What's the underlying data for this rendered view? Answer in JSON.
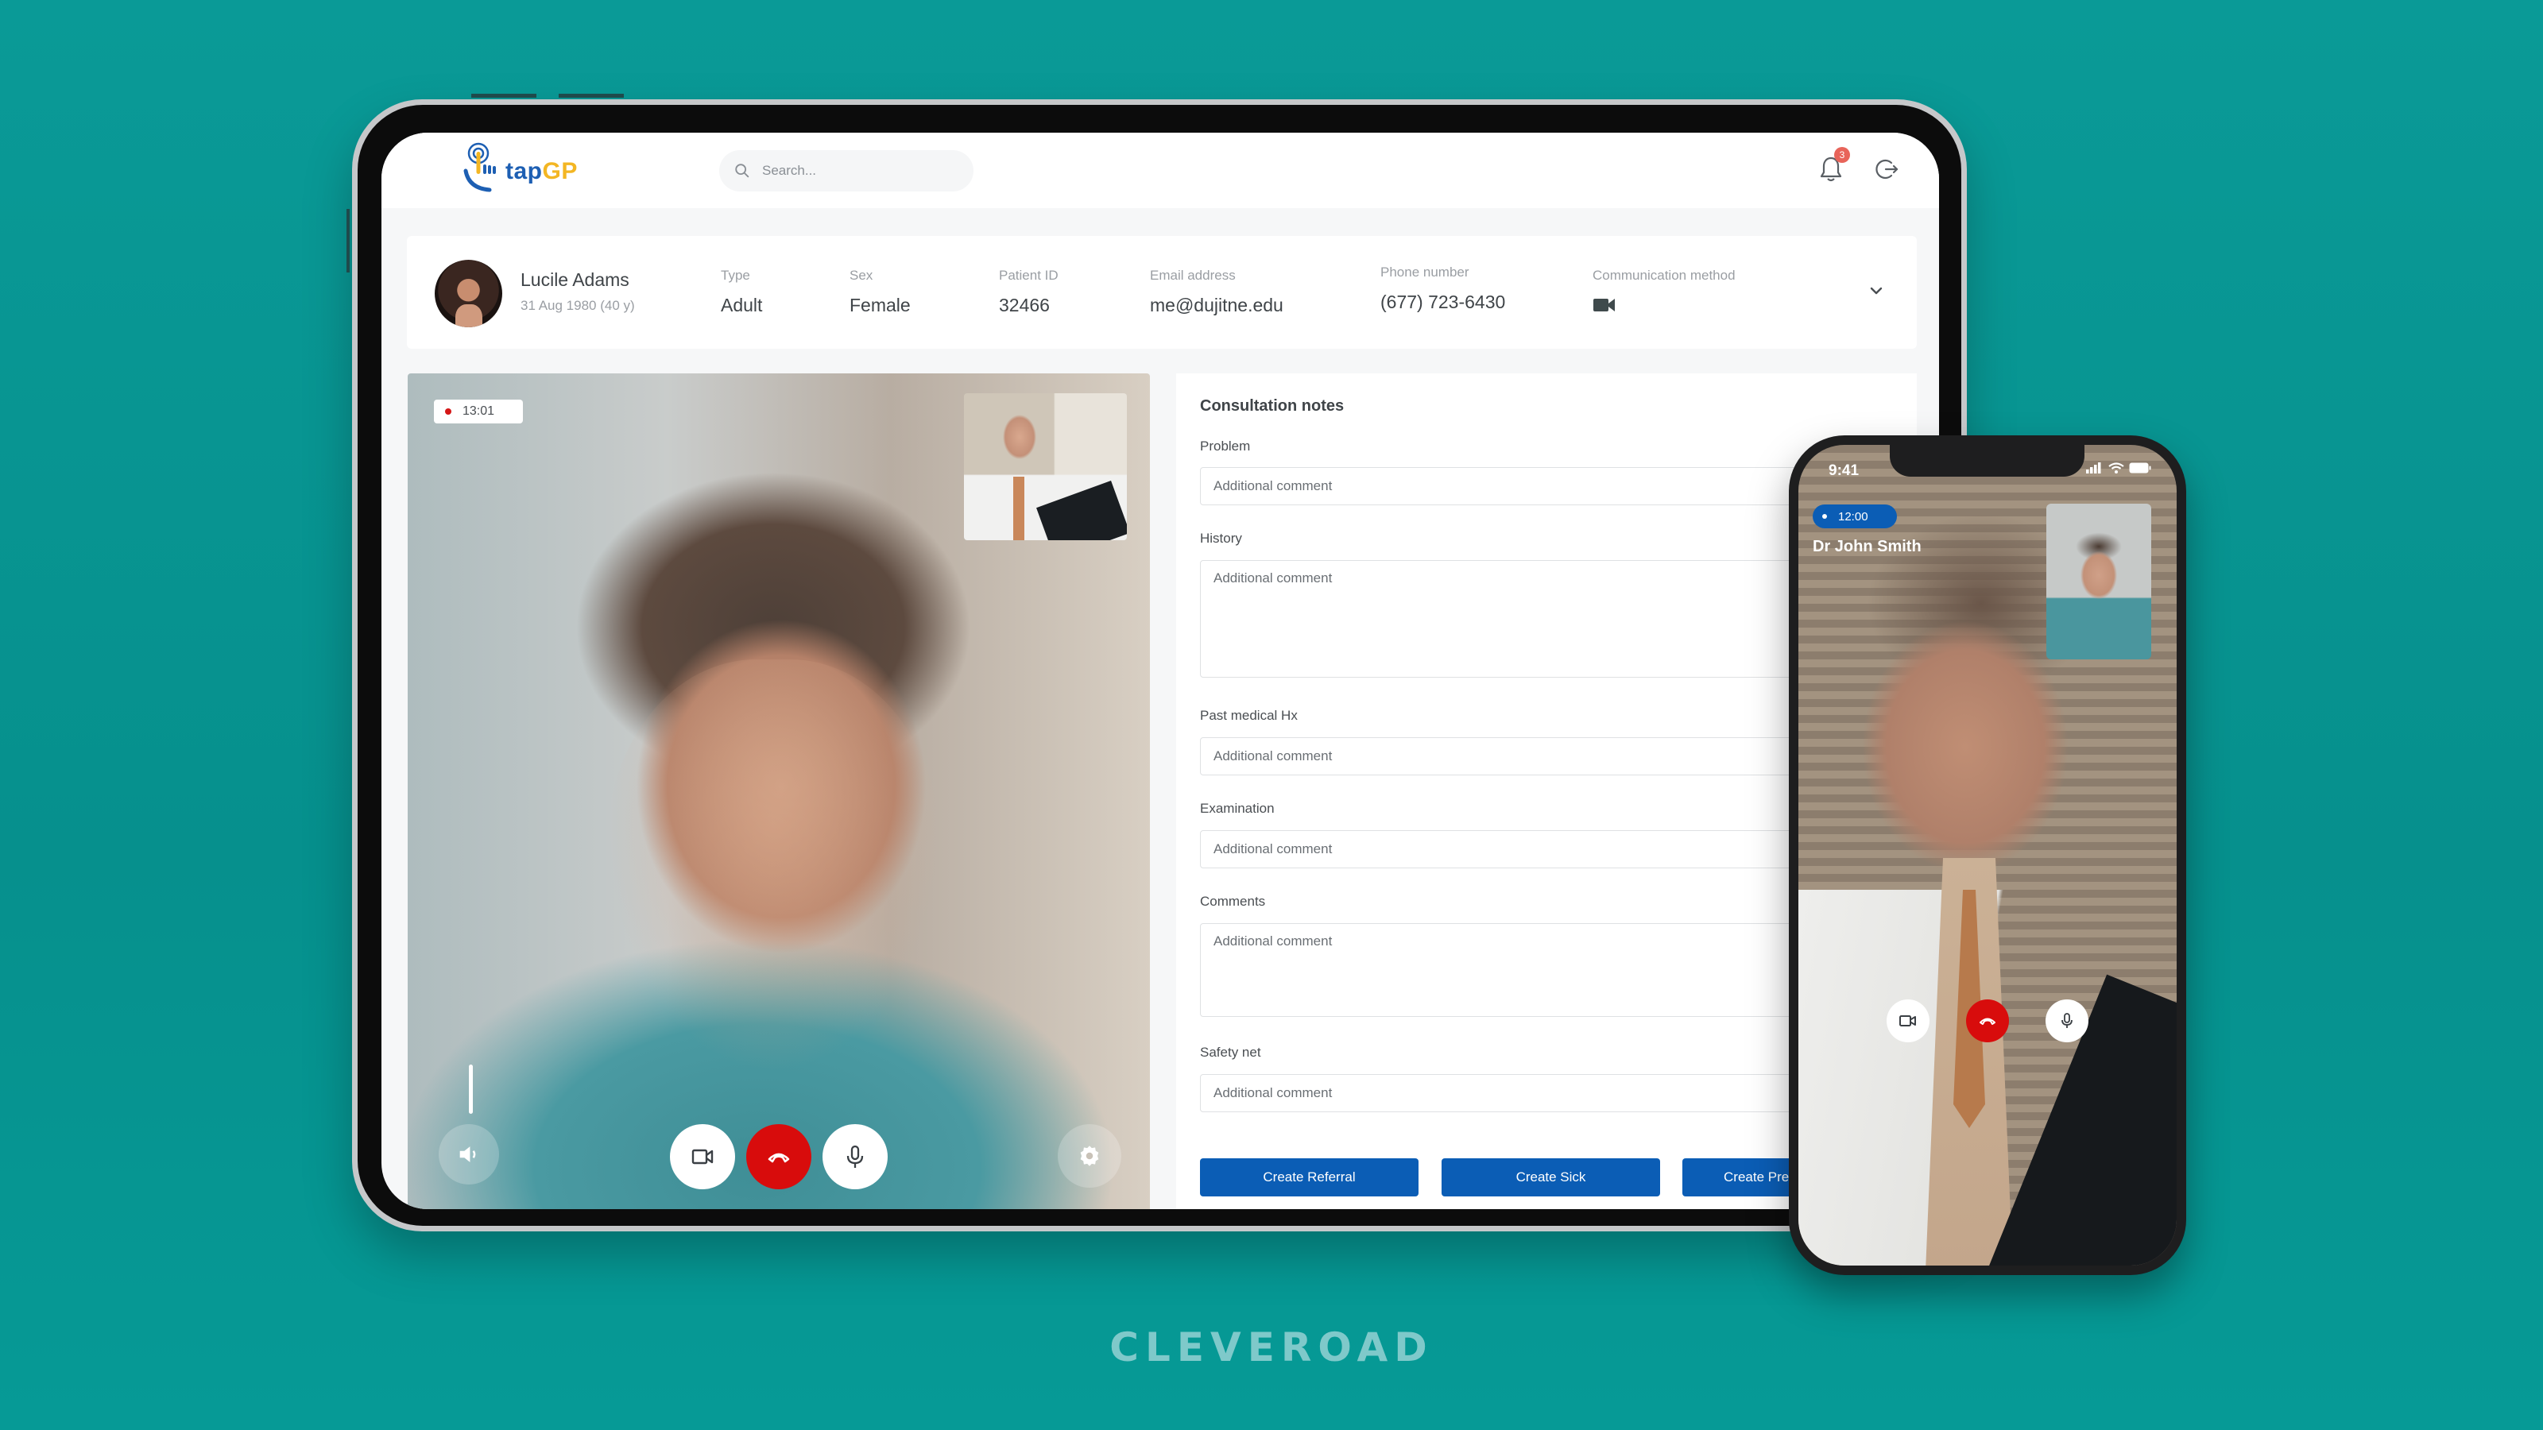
{
  "app": {
    "logo": {
      "text_primary": "tap",
      "text_accent": "GP",
      "colors": {
        "primary": "#1d5fb3",
        "accent": "#f3b623"
      }
    },
    "search": {
      "placeholder": "Search...",
      "value": ""
    },
    "header_icons": {
      "notifications": {
        "icon": "bell-icon",
        "badge_count": "3"
      },
      "logout": {
        "icon": "logout-icon"
      }
    }
  },
  "patient": {
    "name": "Lucile Adams",
    "dob": "31 Aug 1980 (40 y)",
    "fields": [
      {
        "label": "Type",
        "value": "Adult"
      },
      {
        "label": "Sex",
        "value": "Female"
      },
      {
        "label": "Patient ID",
        "value": "32466"
      },
      {
        "label": "Email address",
        "value": "me@dujitne.edu"
      },
      {
        "label": "Phone number",
        "value": "(677) 723-6430"
      },
      {
        "label": "Communication method",
        "value_icon": "video-camera-icon"
      }
    ],
    "expand_icon": "chevron-down-icon"
  },
  "video_call": {
    "timer": "13:01",
    "recording_color": "#d51717",
    "controls": {
      "volume": "volume-icon",
      "camera": "video-camera-icon",
      "hangup": "phone-hangup-icon",
      "mic": "microphone-icon",
      "settings": "gear-icon"
    },
    "hangup_color": "#d80c0c"
  },
  "consultation": {
    "title": "Consultation notes",
    "fields": [
      {
        "label": "Problem",
        "placeholder": "Additional comment",
        "value": "",
        "multiline": false
      },
      {
        "label": "History",
        "placeholder": "Additional comment",
        "value": "",
        "multiline": true
      },
      {
        "label": "Past medical Hx",
        "placeholder": "Additional comment",
        "value": "",
        "multiline": false
      },
      {
        "label": "Examination",
        "placeholder": "Additional comment",
        "value": "",
        "multiline": false
      },
      {
        "label": "Comments",
        "placeholder": "Additional comment",
        "value": "",
        "multiline": true
      },
      {
        "label": "Safety net",
        "placeholder": "Additional comment",
        "value": "",
        "multiline": false
      }
    ],
    "actions": [
      {
        "label": "Create Referral"
      },
      {
        "label": "Create Sick"
      },
      {
        "label": "Create Pre"
      }
    ],
    "button_color": "#0b5db5"
  },
  "phone": {
    "status_time": "9:41",
    "status_icons": [
      "signal-icon",
      "wifi-icon",
      "battery-icon"
    ],
    "call_timer": "12:00",
    "caller_name": "Dr John Smith",
    "controls": {
      "camera": "video-camera-icon",
      "hangup": "phone-hangup-icon",
      "mic": "microphone-icon"
    }
  },
  "brand": {
    "text": "CLEVEROAD"
  },
  "background_color": "#069a96"
}
